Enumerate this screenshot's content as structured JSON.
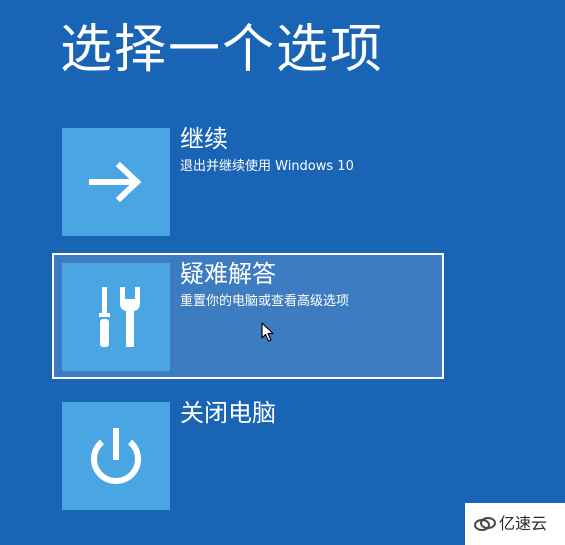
{
  "page": {
    "title": "选择一个选项"
  },
  "options": [
    {
      "title": "继续",
      "description": "退出并继续使用 Windows 10",
      "icon": "arrow-right-icon"
    },
    {
      "title": "疑难解答",
      "description": "重置你的电脑或查看高级选项",
      "icon": "tools-icon"
    },
    {
      "title": "关闭电脑",
      "description": "",
      "icon": "power-icon"
    }
  ],
  "watermark": {
    "text": "亿速云"
  },
  "colors": {
    "background": "#1a64b5",
    "tile": "#4aa6e3",
    "focused_background": "#3d7cc0",
    "text": "#ffffff"
  }
}
